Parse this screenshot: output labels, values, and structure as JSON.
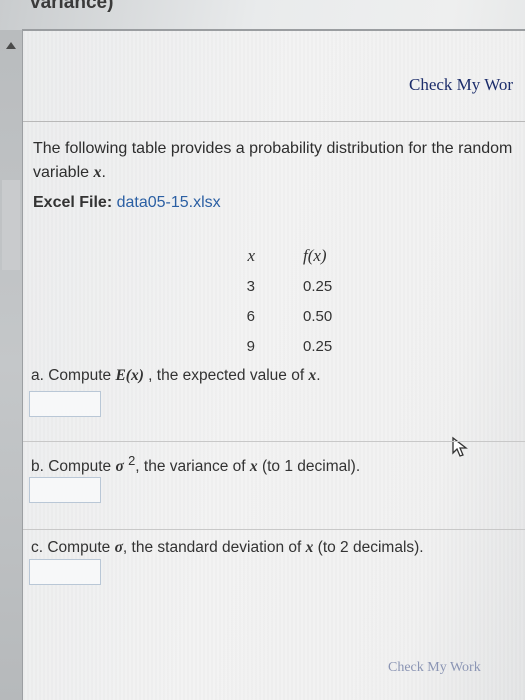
{
  "header": {
    "title": "variance)"
  },
  "toolbar": {
    "check_my_work_label": "Check My Wor"
  },
  "problem": {
    "intro_text": "The following table provides a probability distribution for the random variable",
    "variable_symbol": "x",
    "intro_end": ".",
    "excel_label": "Excel File:",
    "excel_file": "data05-15.xlsx"
  },
  "table": {
    "headers": [
      "x",
      "f(x)"
    ],
    "rows": [
      {
        "x": "3",
        "fx": "0.25"
      },
      {
        "x": "6",
        "fx": "0.50"
      },
      {
        "x": "9",
        "fx": "0.25"
      }
    ]
  },
  "questions": {
    "a": {
      "prefix": "a. Compute ",
      "expr": "E(x)",
      "suffix": " , the expected value of ",
      "var": "x",
      "end": "."
    },
    "b": {
      "prefix": "b. Compute ",
      "expr": "σ",
      "sup": "2",
      "suffix": ", the variance of ",
      "var": "x",
      "end": " (to 1 decimal)."
    },
    "c": {
      "prefix": "c. Compute ",
      "expr": "σ",
      "suffix": ", the standard deviation of ",
      "var": "x",
      "end": " (to 2 decimals)."
    }
  },
  "footer": {
    "check_my_work_label": "Check My Work"
  },
  "colors": {
    "link": "#2b5fa3",
    "button_text": "#1c2d6b",
    "input_border": "#b9c7d6"
  }
}
